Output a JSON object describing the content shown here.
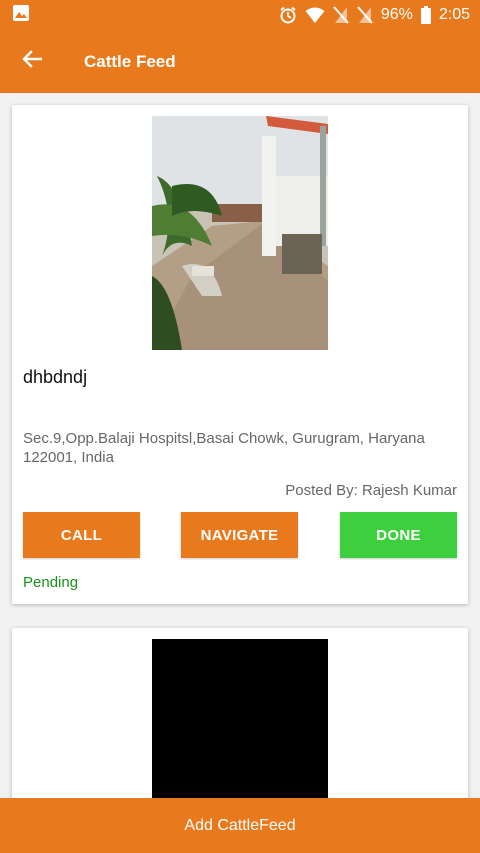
{
  "status_bar": {
    "battery": "96%",
    "time": "2:05",
    "icons": [
      "image-notification-icon",
      "alarm-icon",
      "wifi-icon",
      "no-sim-icon",
      "no-sim-icon",
      "battery-icon"
    ]
  },
  "app_bar": {
    "title": "Cattle Feed",
    "back_icon": "arrow-left-icon"
  },
  "colors": {
    "primary": "#e8791c",
    "done_button": "#3dcf3d",
    "status_pending": "#17921a"
  },
  "cards": [
    {
      "title": "dhbdndj",
      "address": "Sec.9,Opp.Balaji Hospitsl,Basai Chowk, Gurugram, Haryana 122001, India",
      "posted_by": "Posted By: Rajesh Kumar",
      "call_label": "CALL",
      "navigate_label": "NAVIGATE",
      "done_label": "DONE",
      "status": "Pending"
    }
  ],
  "bottom_action": {
    "label": "Add CattleFeed"
  }
}
